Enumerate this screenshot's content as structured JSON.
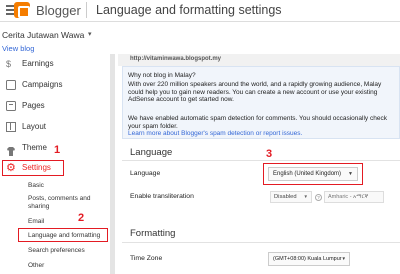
{
  "header": {
    "brand": "Blogger",
    "page_title": "Language and formatting settings"
  },
  "blog": {
    "name": "Cerita Jutawan Wawa",
    "caret": "▾",
    "view_blog": "View blog"
  },
  "sidebar": {
    "items": [
      {
        "label": "Earnings",
        "icon": "dollar-icon"
      },
      {
        "label": "Campaigns",
        "icon": "campaigns-icon"
      },
      {
        "label": "Pages",
        "icon": "pages-icon"
      },
      {
        "label": "Layout",
        "icon": "layout-icon"
      },
      {
        "label": "Theme",
        "icon": "theme-icon"
      },
      {
        "label": "Settings",
        "icon": "gear-icon"
      }
    ],
    "settings_sub": [
      {
        "label": "Basic"
      },
      {
        "label": "Posts, comments and sharing"
      },
      {
        "label": "Email"
      },
      {
        "label": "Language and formatting"
      },
      {
        "label": "Search preferences"
      },
      {
        "label": "Other"
      }
    ]
  },
  "annotations": {
    "n1": "1",
    "n2": "2",
    "n3": "3",
    "color": "#e31b23"
  },
  "main": {
    "watermark": "http://vitaminwawa.blogspot.my",
    "notice_title": "Why not blog in Malay?",
    "notice_body": "With over 220 million speakers around the world, and a rapidly growing audience, Malay could help you to gain new readers. You can create a new account or use your existing AdSense account to get started now.",
    "notice2_text": "We have enabled automatic spam detection for comments. You should occasionally check your spam folder.",
    "notice2_link": "Learn more about Blogger's spam detection or report issues.",
    "language_section": "Language",
    "language_label": "Language",
    "language_value": "English (United Kingdom)",
    "select_caret": "▼",
    "translit_label": "Enable transliteration",
    "translit_value": "Disabled",
    "translit_help": "?",
    "translit_lang": "Amharic - አማርኛ",
    "formatting_section": "Formatting",
    "timezone_label": "Time Zone",
    "timezone_value": "(GMT+08:00) Kuala Lumpur"
  }
}
